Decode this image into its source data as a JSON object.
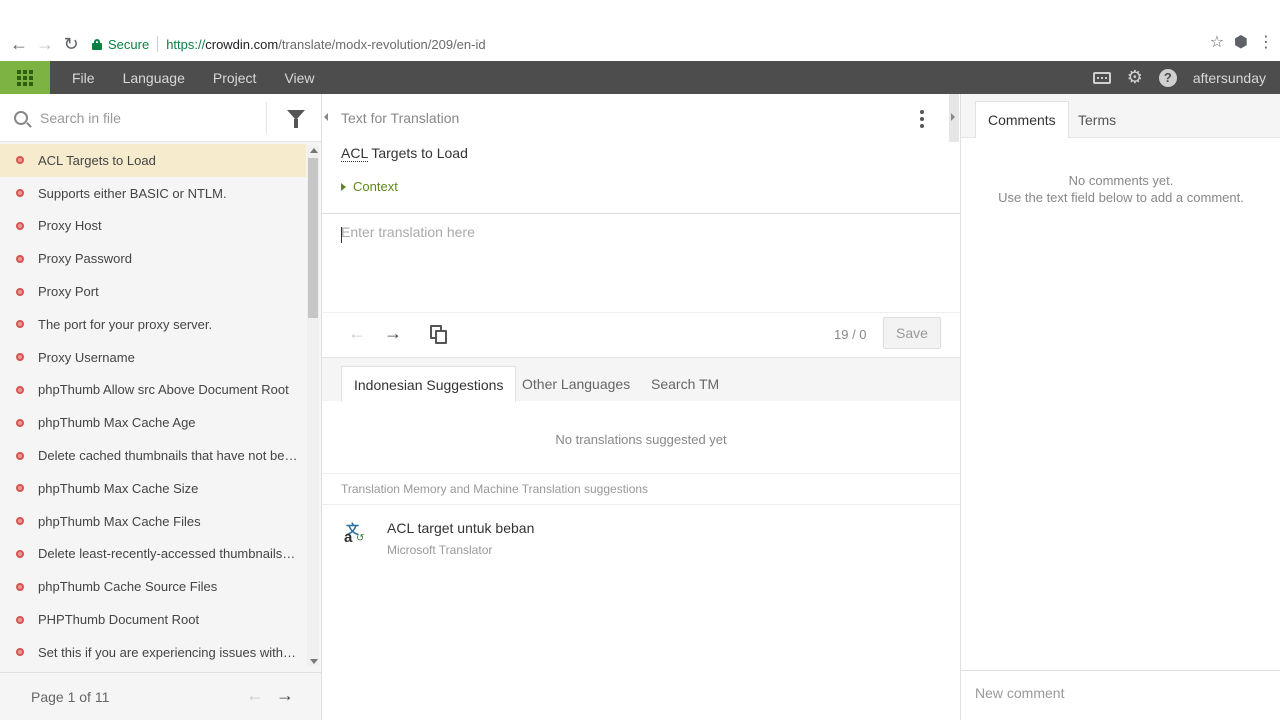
{
  "browser": {
    "secure_label": "Secure",
    "url_scheme": "https://",
    "url_host": "crowdin.com",
    "url_path": "/translate/modx-revolution/209/en-id"
  },
  "menu": {
    "items": [
      "File",
      "Language",
      "Project",
      "View"
    ],
    "username": "aftersunday"
  },
  "sidebar": {
    "search_placeholder": "Search in file",
    "strings": [
      "ACL Targets to Load",
      "Supports either BASIC or NTLM.",
      "Proxy Host",
      "Proxy Password",
      "Proxy Port",
      "The port for your proxy server.",
      "Proxy Username",
      "phpThumb Allow src Above Document Root",
      "phpThumb Max Cache Age",
      "Delete cached thumbnails that have not be…",
      "phpThumb Max Cache Size",
      "phpThumb Max Cache Files",
      "Delete least-recently-accessed thumbnails …",
      "phpThumb Cache Source Files",
      "PHPThumb Document Root",
      "Set this if you are experiencing issues with t…"
    ],
    "active_index": 0,
    "page_label": "Page 1 of 11"
  },
  "editor": {
    "source_header": "Text for Translation",
    "source_abbr": "ACL",
    "source_rest": " Targets to Load",
    "context_label": "Context",
    "translation_placeholder": "Enter translation here",
    "counter": "19 / 0",
    "save_label": "Save"
  },
  "suggestions": {
    "tabs": [
      "Indonesian Suggestions",
      "Other Languages",
      "Search TM"
    ],
    "active_tab": 0,
    "empty_text": "No translations suggested yet",
    "tm_header": "Translation Memory and Machine Translation suggestions",
    "items": [
      {
        "text": "ACL target untuk beban",
        "source": "Microsoft Translator"
      }
    ]
  },
  "comments": {
    "tabs": [
      "Comments",
      "Terms"
    ],
    "empty_line1": "No comments yet.",
    "empty_line2": "Use the text field below to add a comment.",
    "input_placeholder": "New comment"
  },
  "colors": {
    "accent_green": "#7cb342",
    "appbar": "#4d4d4d",
    "active_row": "#f6eccd",
    "untranslated_dot": "#d9534f"
  }
}
